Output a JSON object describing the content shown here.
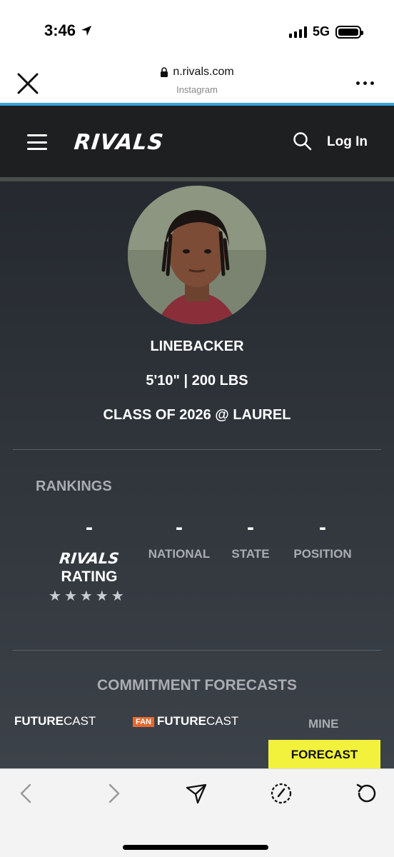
{
  "status_bar": {
    "time": "3:46",
    "network": "5G"
  },
  "browser": {
    "url": "n.rivals.com",
    "source": "Instagram"
  },
  "header": {
    "logo": "RIVALS",
    "login": "Log In"
  },
  "profile": {
    "position": "LINEBACKER",
    "measurables": "5'10\"  |  200 LBS",
    "class_line": "CLASS OF 2026 @ LAUREL"
  },
  "rankings": {
    "title": "RANKINGS",
    "rating_logo": "RIVALS",
    "rating_label": "RATING",
    "rating_value": "-",
    "stars": 5,
    "national_value": "-",
    "national_label": "NATIONAL",
    "state_value": "-",
    "state_label": "STATE",
    "position_value": "-",
    "position_label": "POSITION"
  },
  "forecasts": {
    "title": "COMMITMENT FORECASTS",
    "futurecast_bold": "FUTURE",
    "futurecast_light": "CAST",
    "fan_badge": "FAN",
    "fan_futurecast_bold": "FUTURE",
    "fan_futurecast_light": "CAST",
    "mine": "MINE",
    "forecast_button": "FORECAST"
  },
  "colors": {
    "accent_yellow": "#f2f23d",
    "header_bg": "#1d1f21",
    "fan_orange": "#e8682b"
  }
}
